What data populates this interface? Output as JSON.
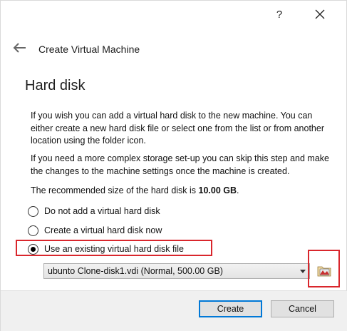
{
  "titlebar": {
    "help_label": "?",
    "close_icon": "close-icon",
    "back_icon": "back-arrow-icon"
  },
  "header": {
    "title": "Create Virtual Machine"
  },
  "section": {
    "title": "Hard disk",
    "paragraph1": "If you wish you can add a virtual hard disk to the new machine. You can either create a new hard disk file or select one from the list or from another location using the folder icon.",
    "paragraph2": "If you need a more complex storage set-up you can skip this step and make the changes to the machine settings once the machine is created.",
    "recommended_prefix": "The recommended size of the hard disk is ",
    "recommended_size": "10.00 GB",
    "recommended_suffix": "."
  },
  "options": [
    {
      "label": "Do not add a virtual hard disk",
      "checked": false
    },
    {
      "label": "Create a virtual hard disk now",
      "checked": false
    },
    {
      "label": "Use an existing virtual hard disk file",
      "checked": true
    }
  ],
  "disk_select": {
    "value": "ubunto Clone-disk1.vdi (Normal, 500.00 GB)",
    "arrow_icon": "chevron-down-icon",
    "folder_icon": "folder-icon"
  },
  "footer": {
    "create_label": "Create",
    "cancel_label": "Cancel"
  },
  "colors": {
    "highlight": "#d9262c",
    "default_button_border": "#0078d7"
  }
}
